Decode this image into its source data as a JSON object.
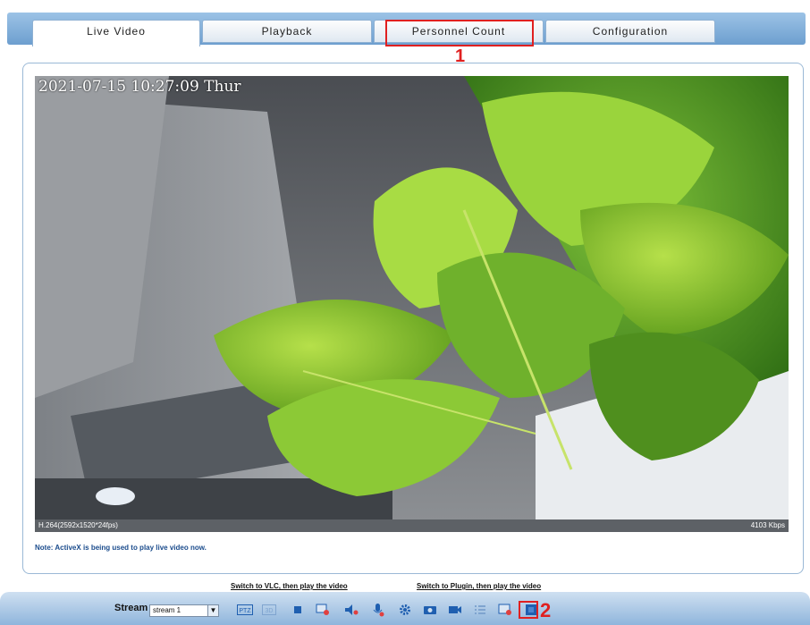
{
  "tabs": [
    {
      "label": "Live Video"
    },
    {
      "label": "Playback"
    },
    {
      "label": "Personnel Count"
    },
    {
      "label": "Configuration"
    }
  ],
  "callouts": {
    "one": "1",
    "two": "2"
  },
  "video": {
    "osd_text": "2021-07-15 10:27:09 Thur",
    "codec_info": "H.264(2592x1520*24fps)",
    "bitrate": "4103 Kbps"
  },
  "note": "Note: ActiveX is being used to play live video now.",
  "links": {
    "vlc": "Switch to VLC, then play the video",
    "plugin": "Switch to Plugin, then play the video"
  },
  "toolbar": {
    "stream_label": "Stream",
    "stream_value": "stream 1",
    "icons": [
      "ptz-icon",
      "3d-icon",
      "stop-icon",
      "record-icon",
      "audio-icon",
      "mic-icon",
      "settings-icon",
      "snapshot-icon",
      "video-icon",
      "list-icon",
      "region-icon",
      "personnel-count-icon"
    ]
  },
  "colors": {
    "accent": "#1f5fb0",
    "callout": "#e02020"
  }
}
